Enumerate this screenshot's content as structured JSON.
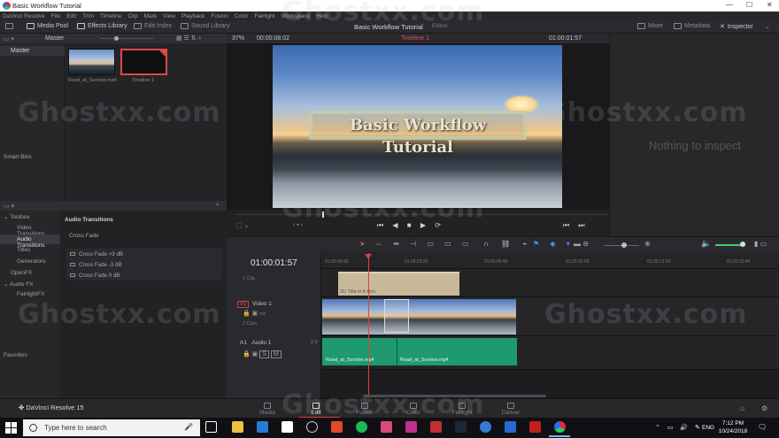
{
  "window": {
    "title": "Basic Workflow Tutorial",
    "controls": [
      "—",
      "☐",
      "✕"
    ]
  },
  "menu": [
    "DaVinci Resolve",
    "File",
    "Edit",
    "Trim",
    "Timeline",
    "Clip",
    "Mark",
    "View",
    "Playback",
    "Fusion",
    "Color",
    "Fairlight",
    "Workspace",
    "Help"
  ],
  "toolbar": {
    "media_pool": "Media Pool",
    "effects_library": "Effects Library",
    "edit_index": "Edit Index",
    "sound_library": "Sound Library",
    "project_title": "Basic Workflow Tutorial",
    "project_state": "Edited",
    "mixer": "Mixer",
    "metadata": "Metadata",
    "inspector": "Inspector"
  },
  "bins": {
    "header": "Master",
    "items": [
      "Master"
    ],
    "smart_bins": "Smart Bins",
    "favorites": "Favorites"
  },
  "media_pool": {
    "clips": [
      {
        "name": "Road_at_Sunrise.mp4"
      },
      {
        "name": "Timeline 1"
      }
    ]
  },
  "viewer": {
    "zoom": "37%",
    "source_tc": "00:00:08:02",
    "timeline_name": "Timeline 1",
    "record_tc": "01:00:01:57",
    "title_text": "Basic Workflow Tutorial"
  },
  "inspector": {
    "empty_text": "Nothing to inspect"
  },
  "effects": {
    "tree": [
      "Toolbox",
      "Video Transitions",
      "Audio Transitions",
      "Titles",
      "Generators",
      "OpenFX",
      "Audio FX",
      "FairlightFX"
    ],
    "selected": "Audio Transitions",
    "panel_title": "Audio Transitions",
    "group": "Cross Fade",
    "items": [
      "Cross Fade +3 dB",
      "Cross Fade -3 dB",
      "Cross Fade 0 dB"
    ]
  },
  "timeline": {
    "timecode": "01:00:01:57",
    "ruler": [
      "01:00:00:00",
      "01:00:03:20",
      "01:00:06:40",
      "01:00:10:00",
      "01:00:13:20",
      "01:00:16:40"
    ],
    "tracks": [
      {
        "label": "",
        "name": "",
        "clips": "1 Clip"
      },
      {
        "label": "V1",
        "name": "Video 1",
        "clips": "2 Clips"
      },
      {
        "label": "A1",
        "name": "Audio 1",
        "channels": "2.0"
      }
    ],
    "title_clip": "3D Title in A Box",
    "audio_clips": [
      "Road_at_Sunrise.mp4",
      "Road_at_Sunrise.mp4"
    ],
    "btn_s": "S",
    "btn_m": "M"
  },
  "pages": [
    "Media",
    "Edit",
    "Fusion",
    "Color",
    "Fairlight",
    "Deliver"
  ],
  "active_page": "Edit",
  "brand": "DaVinci Resolve 15",
  "taskbar": {
    "search_placeholder": "Type here to search",
    "time": "7:12 PM",
    "date": "10/24/2018",
    "lang": "ENG"
  },
  "watermark": "Ghostxx.com",
  "colors": {
    "accent_red": "#e04040",
    "audio_green": "#1f9a6e",
    "title_clip": "#c8b99a"
  }
}
